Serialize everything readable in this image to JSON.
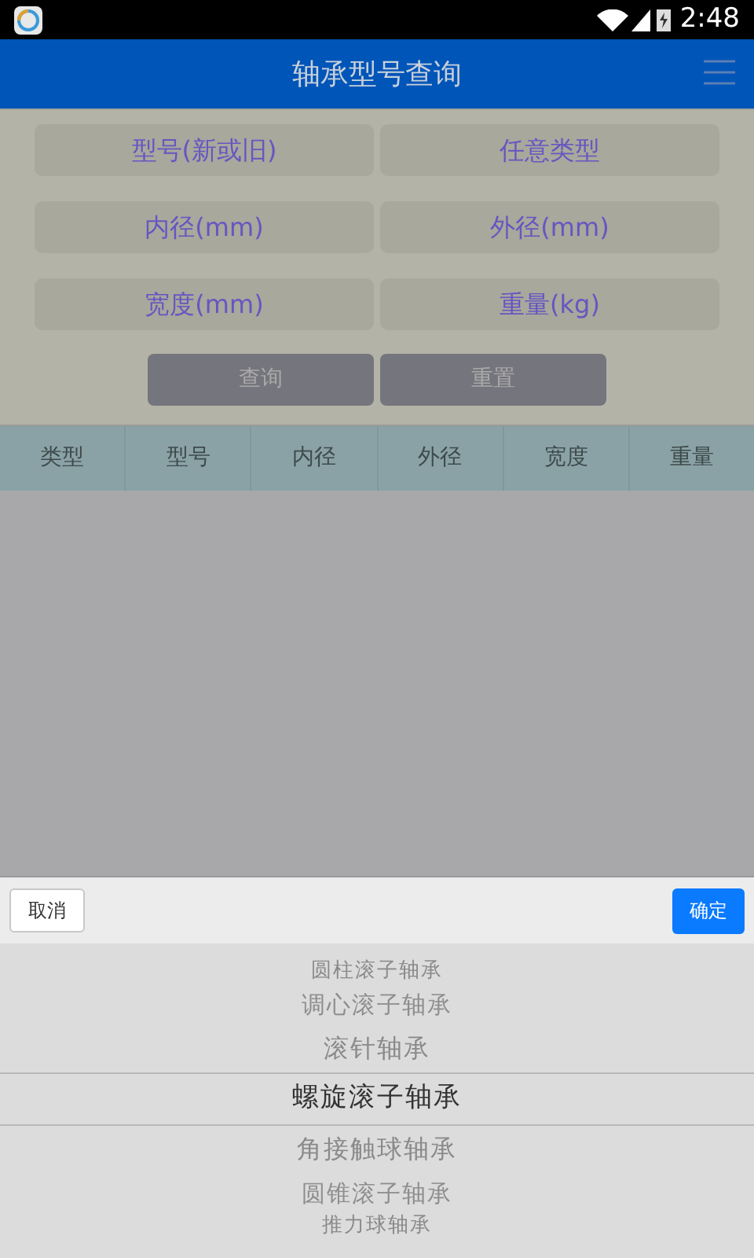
{
  "status_bar": {
    "time": "2:48"
  },
  "app_bar": {
    "title": "轴承型号查询"
  },
  "fields": [
    {
      "placeholder": "型号(新或旧)"
    },
    {
      "placeholder": "任意类型"
    },
    {
      "placeholder": "内径(mm)"
    },
    {
      "placeholder": "外径(mm)"
    },
    {
      "placeholder": "宽度(mm)"
    },
    {
      "placeholder": "重量(kg)"
    }
  ],
  "buttons": [
    "查询",
    "重置"
  ],
  "table": {
    "columns": [
      "类型",
      "型号",
      "内径",
      "外径",
      "宽度",
      "重量"
    ]
  },
  "picker": {
    "cancel": "取消",
    "confirm": "确定",
    "options": [
      {
        "label": "圆柱滚子轴承",
        "selected": false
      },
      {
        "label": "调心滚子轴承",
        "selected": false
      },
      {
        "label": "滚针轴承",
        "selected": false
      },
      {
        "label": "螺旋滚子轴承",
        "selected": true
      },
      {
        "label": "角接触球轴承",
        "selected": false
      },
      {
        "label": "圆锥滚子轴承",
        "selected": false
      },
      {
        "label": "推力球轴承",
        "selected": false
      }
    ]
  }
}
